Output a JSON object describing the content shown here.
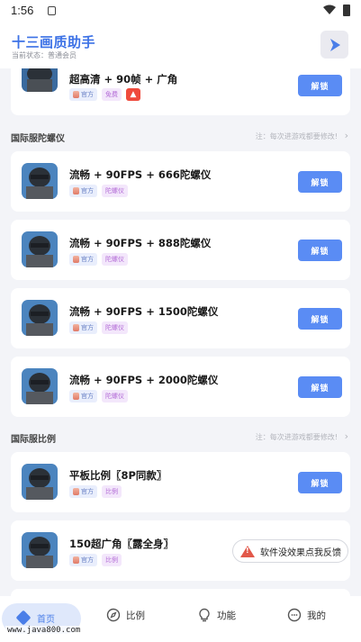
{
  "status_bar": {
    "time": "1:56"
  },
  "app": {
    "title": "十三画质助手",
    "subtitle": "当前状态：普通会员"
  },
  "unlock_label": "解锁",
  "tags": {
    "official": "官方",
    "free": "免费",
    "gyro": "陀螺仪",
    "ratio": "比例"
  },
  "top_card": {
    "title": "超高清 + 90帧 + 广角"
  },
  "sections": [
    {
      "title": "国际服陀螺仪",
      "note": "注：每次进游戏都要修改!",
      "cards": [
        {
          "title": "流畅 + 90FPS + 666陀螺仪"
        },
        {
          "title": "流畅 + 90FPS + 888陀螺仪"
        },
        {
          "title": "流畅 + 90FPS + 1500陀螺仪"
        },
        {
          "title": "流畅 + 90FPS + 2000陀螺仪"
        }
      ]
    },
    {
      "title": "国际服比例",
      "note": "注：每次进游戏都要修改!",
      "cards": [
        {
          "title": "平板比例〖8P同款〗"
        },
        {
          "title": "150超广角〖露全身〗"
        }
      ]
    }
  ],
  "feedback": {
    "label": "软件没效果点我反馈"
  },
  "bottom_nav": {
    "home": "首页",
    "ratio": "比例",
    "function": "功能",
    "mine": "我的"
  },
  "watermark": "www.java800.com",
  "colors": {
    "accent": "#3d72e6",
    "button": "#5a8cf4",
    "warn": "#e2584a"
  }
}
